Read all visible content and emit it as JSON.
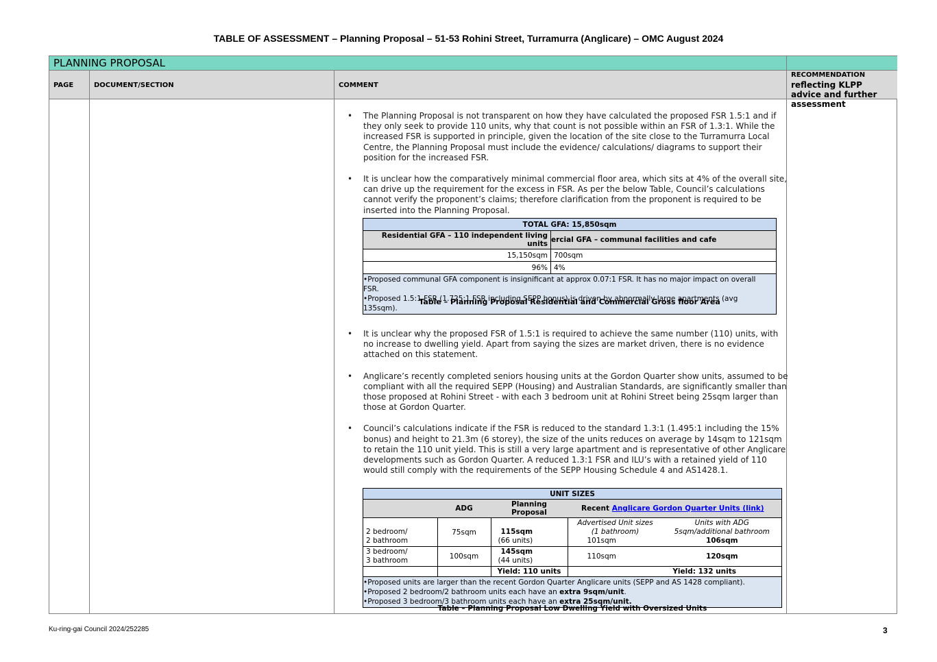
{
  "document": {
    "title": "TABLE OF ASSESSMENT – Planning Proposal – 51-53 Rohini Street, Turramurra (Anglicare) – OMC August 2024"
  },
  "section": {
    "band_title": "PLANNING PROPOSAL",
    "columns": {
      "page": "PAGE",
      "document_section": "DOCUMENT/SECTION",
      "comment": "COMMENT",
      "recommendation": "RECOMMENDATION",
      "recommendation_sub": "reflecting KLPP advice and further assessment"
    }
  },
  "comments": [
    "The Planning Proposal is not transparent on how they have calculated the proposed FSR 1.5:1 and if they only seek to provide 110 units, why that count is not possible within an FSR of 1.3:1. While the increased FSR is supported in principle, given the location of the site close to the Turramurra Local Centre, the Planning Proposal must include the evidence/ calculations/ diagrams to support their position for the increased FSR.",
    "It is unclear how the comparatively minimal commercial floor area, which sits at 4% of the overall site, can drive up the requirement for the excess in FSR. As per the below Table, Council’s calculations cannot verify the proponent’s claims; therefore clarification from the proponent is required to be inserted into the Planning Proposal.",
    "It is unclear why the proposed FSR of 1.5:1 is required to achieve the same number (110) units, with no increase to dwelling yield. Apart from saying the sizes are market driven, there is no evidence attached on this statement.",
    "Anglicare’s recently completed seniors housing units at the Gordon Quarter show units, assumed to be compliant with all the required SEPP (Housing) and Australian Standards, are significantly smaller than those proposed at Rohini Street - with each 3 bedroom unit at Rohini Street being 25sqm larger than those at Gordon Quarter.",
    "Council’s calculations indicate if the FSR is reduced to the standard 1.3:1 (1.495:1 including the 15% bonus) and height to 21.3m (6 storey), the size of the units reduces on average by 14sqm to 121sqm to retain the 110 unit yield. This is still a very large apartment and is representative of other Anglicare developments such as Gordon Quarter. A reduced 1.3:1 FSR and ILU’s with a retained yield of 110 would still comply with the requirements of the SEPP Housing Schedule 4 and AS1428.1."
  ],
  "gfa_table": {
    "title": "TOTAL GFA: 15,850sqm",
    "col1_header": "Residential GFA – 110 independent living units",
    "col2_header": "ercial GFA – communal facilities and cafe",
    "col1_sqm": "15,150sqm",
    "col2_sqm": "700sqm",
    "col1_pct": "96%",
    "col2_pct": "4%",
    "notes": [
      "Proposed communal GFA component is insignificant at approx 0.07:1 FSR. It has no major impact on overall FSR.",
      "Proposed 1.5:1 FSR (1.725:1 FSR including SEPP bonus) is driven by abnormally large apartments (avg 135sqm)."
    ],
    "caption": "Table – Planning Proposal Residential and Commercial Gross floor Area"
  },
  "unit_table": {
    "title": "UNIT SIZES",
    "header_adg": "ADG",
    "header_pp": "Planning Proposal",
    "header_recent_prefix": "Recent ",
    "header_recent_link": "Anglicare Gordon Quarter Units (link)",
    "sub_advertised": "Advertised Unit sizes",
    "sub_advertised2": "(1 bathroom)",
    "sub_adg": "Units with ADG",
    "sub_adg2": "5sqm/additional bathroom",
    "rows": [
      {
        "type_line1": "2 bedroom/",
        "type_line2": "2 bathroom",
        "adg": "75sqm",
        "pp_size": "115sqm",
        "pp_units": "(66 units)",
        "advertised": "101sqm",
        "with_adg": "106sqm"
      },
      {
        "type_line1": "3 bedroom/",
        "type_line2": "3 bathroom",
        "adg": "100sqm",
        "pp_size": "145sqm",
        "pp_units": "(44 units)",
        "advertised": "110sqm",
        "with_adg": "120sqm"
      }
    ],
    "yield_pp": "Yield: 110 units",
    "yield_recent": "Yield: 132 units",
    "notes": {
      "n1": "Proposed units are larger than the recent Gordon Quarter Anglicare units (SEPP and AS 1428 compliant).",
      "n2_pre": "Proposed 2 bedroom/2 bathroom units each have an ",
      "n2_bold": "extra 9sqm/unit",
      "n2_post": ".",
      "n3_pre": "Proposed 3 bedroom/3 bathroom units each have an ",
      "n3_bold": "extra 25sqm/unit."
    },
    "caption": "Table – Planning Proposal Low Dwelling Yield with Oversized Units"
  },
  "footer": {
    "reference": "Ku-ring-gai Council 2024/252285",
    "page_number": "3"
  }
}
